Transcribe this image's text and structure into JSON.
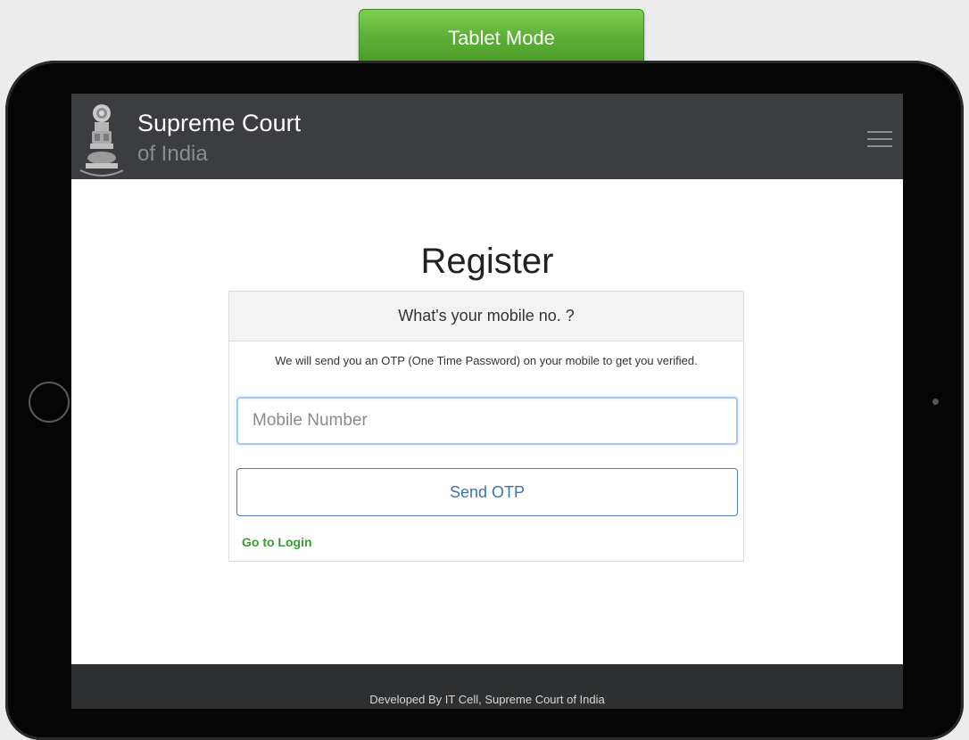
{
  "mode_badge": {
    "label": "Tablet Mode",
    "color": "#5fb238"
  },
  "navbar": {
    "brand_line1": "Supreme Court",
    "brand_line2": "of India",
    "emblem_icon": "emblem-icon",
    "menu_icon": "hamburger-menu-icon",
    "background": "#3b3d40"
  },
  "register": {
    "title": "Register",
    "panel_heading": "What's your mobile no. ?",
    "panel_text": "We will send you an OTP (One Time Password) on your mobile to get you verified.",
    "mobile_placeholder": "Mobile Number",
    "mobile_value": "",
    "send_button": "Send OTP",
    "login_link": "Go to Login"
  },
  "footer": {
    "text": "Developed By IT Cell, Supreme Court of India"
  },
  "colors": {
    "accent_blue": "#3d72b5",
    "link_green": "#3c9a36",
    "footer_bg": "#2d2f31"
  }
}
